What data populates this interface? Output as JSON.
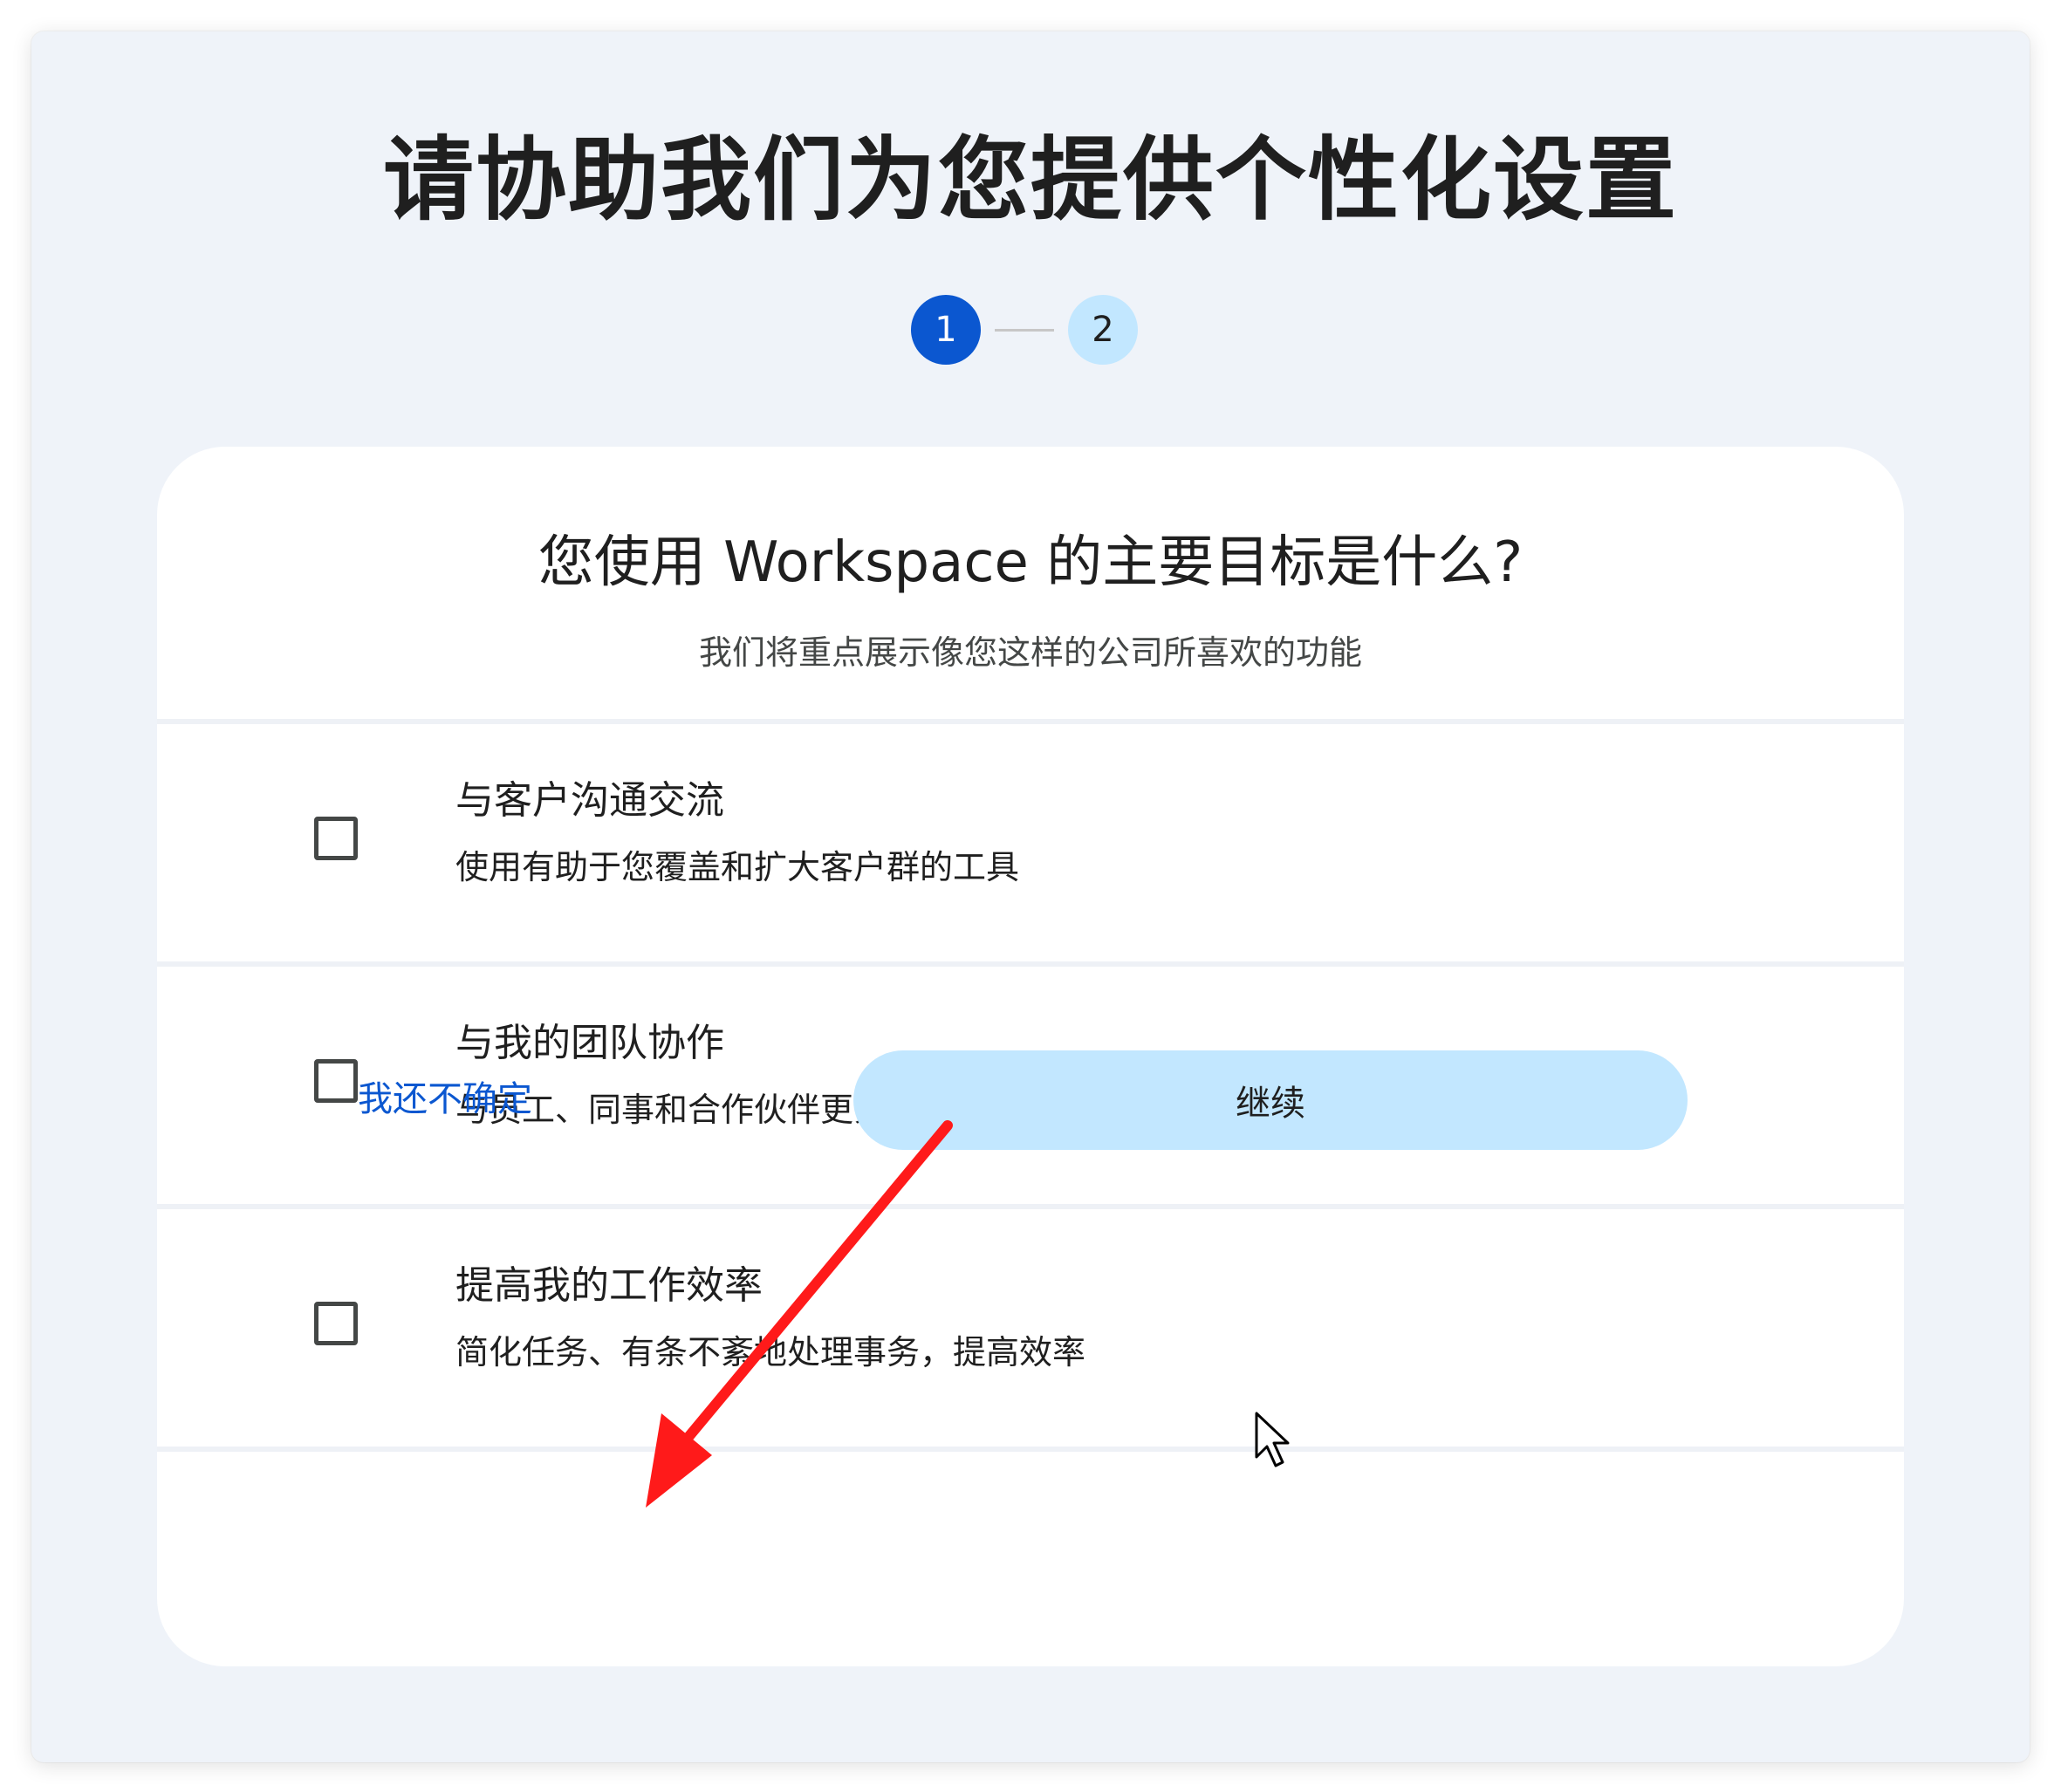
{
  "page": {
    "title": "请协助我们为您提供个性化设置"
  },
  "stepper": {
    "steps": [
      "1",
      "2"
    ],
    "current": 1
  },
  "question": {
    "heading": "您使用 Workspace 的主要目标是什么?",
    "subheading": "我们将重点展示像您这样的公司所喜欢的功能"
  },
  "options": [
    {
      "title": "与客户沟通交流",
      "description": "使用有助于您覆盖和扩大客户群的工具",
      "checked": false
    },
    {
      "title": "与我的团队协作",
      "description": "与员工、同事和合作伙伴更紧密地合作",
      "checked": false
    },
    {
      "title": "提高我的工作效率",
      "description": "简化任务、有条不紊地处理事务，提高效率",
      "checked": false
    }
  ],
  "actions": {
    "unsure_label": "我还不确定",
    "continue_label": "继续"
  },
  "colors": {
    "background": "#eff3f9",
    "primary": "#0b57d0",
    "continue_button": "#c2e7ff",
    "annotation_arrow": "#ff1a1a"
  }
}
